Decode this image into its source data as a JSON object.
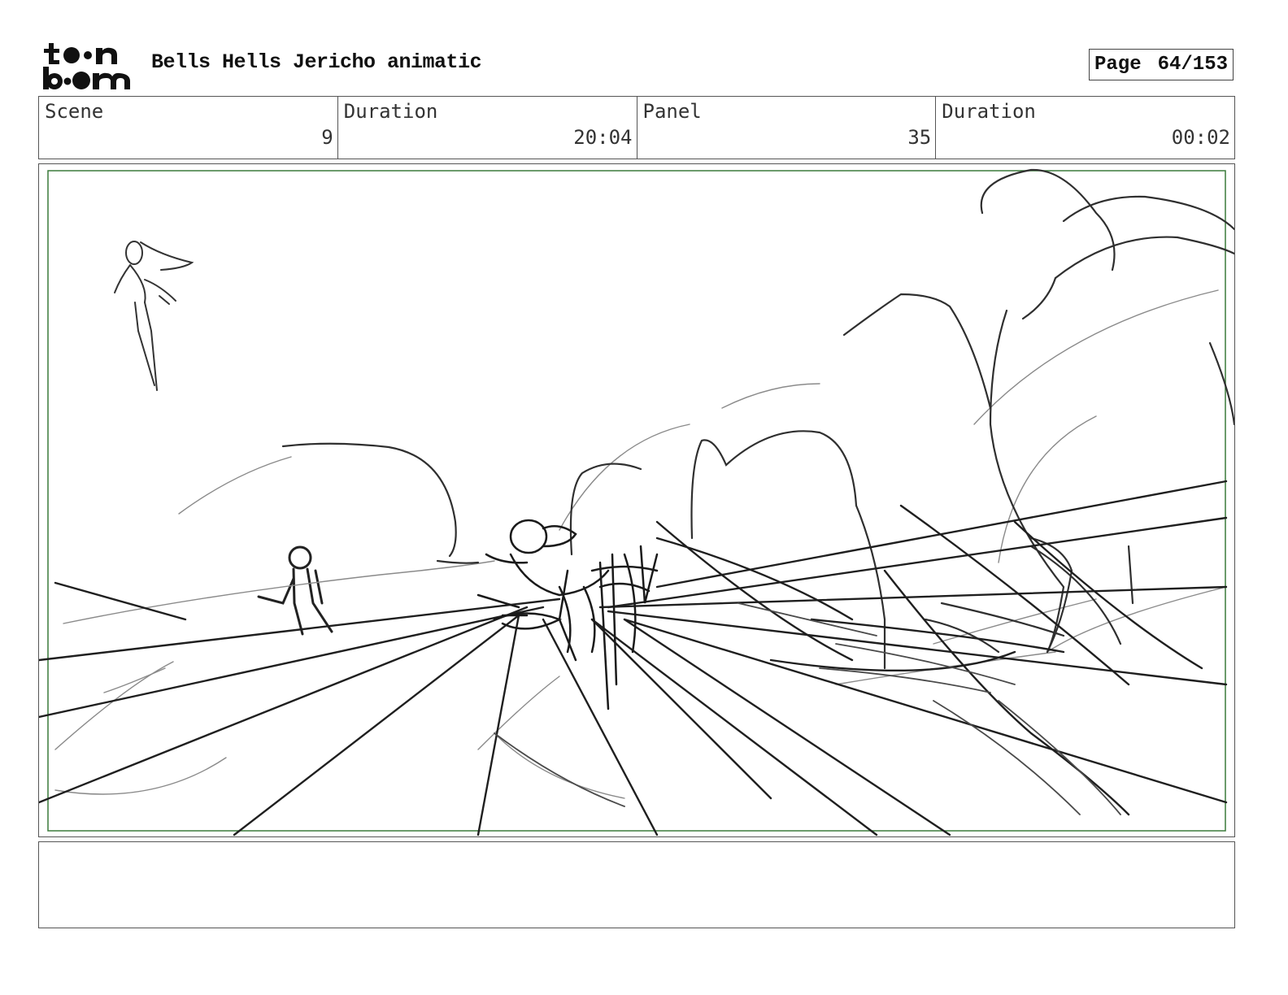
{
  "header": {
    "logo_text": "toon boom",
    "title": "Bells Hells Jericho animatic",
    "page_label": "Page",
    "page_number": "64/153"
  },
  "info": {
    "scene_label": "Scene",
    "scene_value": "9",
    "scene_duration_label": "Duration",
    "scene_duration_value": "20:04",
    "panel_label": "Panel",
    "panel_value": "35",
    "panel_duration_label": "Duration",
    "panel_duration_value": "00:02"
  },
  "notes": {
    "text": ""
  },
  "colors": {
    "safe_frame": "#3a7a3a",
    "sketch_dark": "#2a2a2a",
    "sketch_light": "#8a8a8a"
  }
}
